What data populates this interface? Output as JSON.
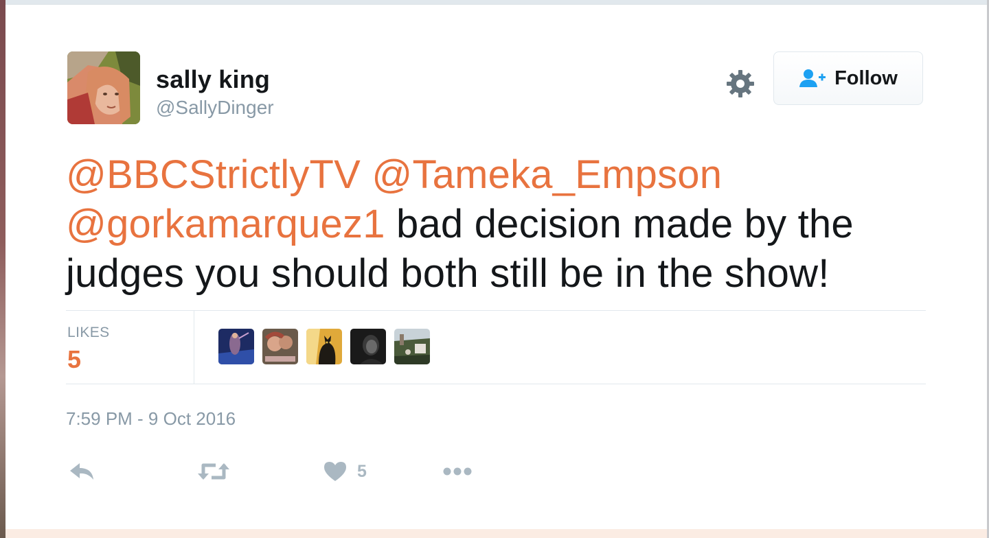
{
  "user": {
    "display_name": "sally king",
    "handle": "@SallyDinger",
    "avatar_icon": "profile-photo"
  },
  "header": {
    "settings_icon": "gear-icon",
    "follow_label": "Follow",
    "follow_icon": "person-plus-icon"
  },
  "tweet": {
    "mentions": [
      "@BBCStrictlyTV",
      "@Tameka_Empson",
      "@gorkamarquez1"
    ],
    "body": "bad decision made by the judges you should both still be in the show!",
    "timestamp": "7:59 PM - 9 Oct 2016"
  },
  "stats": {
    "likes_label": "LIKES",
    "likes_count": "5",
    "likers": [
      {
        "icon": "liker-avatar"
      },
      {
        "icon": "liker-avatar"
      },
      {
        "icon": "liker-avatar"
      },
      {
        "icon": "liker-avatar"
      },
      {
        "icon": "liker-avatar"
      }
    ]
  },
  "actions": {
    "reply_icon": "reply-icon",
    "retweet_icon": "retweet-icon",
    "like_icon": "heart-icon",
    "like_count": "5",
    "more_icon": "more-icon"
  },
  "colors": {
    "accent": "#e8733f",
    "text": "#14171a",
    "muted": "#8899a6",
    "icon_gray": "#aab8c2",
    "follow_icon": "#1da1f2"
  }
}
